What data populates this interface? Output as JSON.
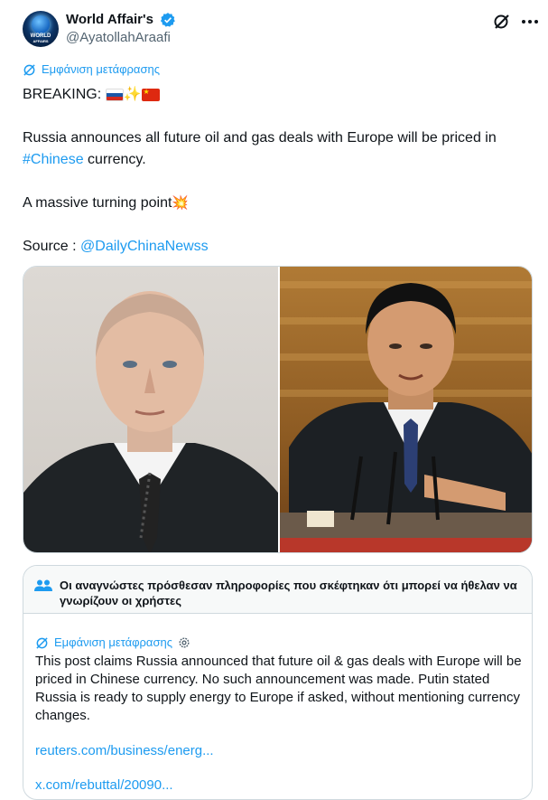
{
  "author": {
    "name": "World Affair's",
    "handle": "@AyatollahAraafi",
    "avatar_text": [
      "WORLD",
      "AFFAIRS"
    ]
  },
  "translate_label": "Εμφάνιση μετάφρασης",
  "tweet": {
    "line1_prefix": "BREAKING: ",
    "line2_pre": " Russia announces all future oil and gas deals with Europe will be priced in ",
    "hashtag": "#Chinese",
    "line2_post": " currency.",
    "line3": "A massive turning point",
    "source_label": "Source : ",
    "source_mention": "@DailyChinaNewss"
  },
  "community_note": {
    "title": "Οι αναγνώστες πρόσθεσαν πληροφορίες που σκέφτηκαν ότι μπορεί να ήθελαν να γνωρίζουν οι χρήστες",
    "translate_label": "Εμφάνιση μετάφρασης",
    "body": "This post claims Russia announced that future oil & gas deals with Europe will be priced in Chinese currency. No such announcement was made. Putin stated Russia is ready to supply energy to Europe if asked, without mentioning currency changes.",
    "link1": "reuters.com/business/energ...",
    "link2": "x.com/rebuttal/20090..."
  },
  "colors": {
    "accent": "#1d9bf0",
    "text": "#0f1419",
    "muted": "#536471",
    "border": "#cfd9de"
  }
}
